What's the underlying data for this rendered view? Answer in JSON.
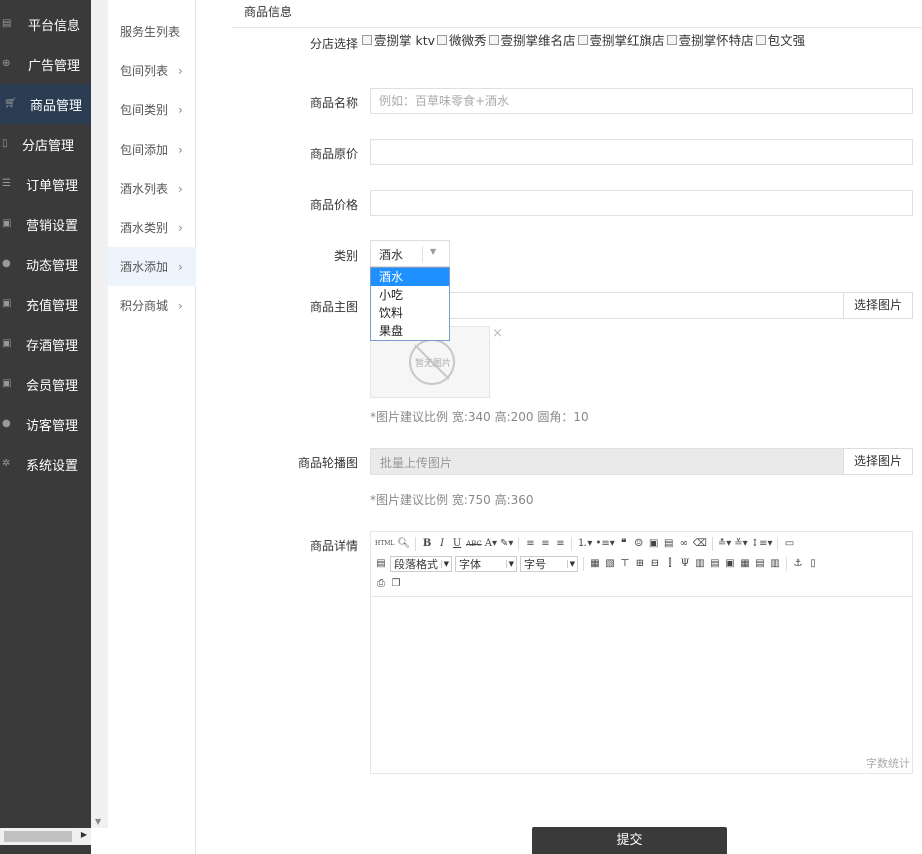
{
  "sidebar": {
    "items": [
      {
        "label": "平台信息",
        "icon": "info-icon"
      },
      {
        "label": "广告管理",
        "icon": "globe-icon"
      },
      {
        "label": "商品管理",
        "icon": "cart-icon",
        "active": true
      },
      {
        "label": "分店管理",
        "icon": "book-icon"
      },
      {
        "label": "订单管理",
        "icon": "list-icon"
      },
      {
        "label": "营销设置",
        "icon": "gift-icon"
      },
      {
        "label": "动态管理",
        "icon": "user-icon"
      },
      {
        "label": "充值管理",
        "icon": "gift-icon"
      },
      {
        "label": "存酒管理",
        "icon": "gift-icon"
      },
      {
        "label": "会员管理",
        "icon": "gift-icon"
      },
      {
        "label": "访客管理",
        "icon": "user-icon"
      },
      {
        "label": "系统设置",
        "icon": "gear-icon"
      }
    ]
  },
  "submenu": {
    "items": [
      {
        "label": "服务生列表",
        "chevron": false
      },
      {
        "label": "包间列表",
        "chevron": true
      },
      {
        "label": "包间类别",
        "chevron": true
      },
      {
        "label": "包间添加",
        "chevron": true
      },
      {
        "label": "酒水列表",
        "chevron": true
      },
      {
        "label": "酒水类别",
        "chevron": true
      },
      {
        "label": "酒水添加",
        "chevron": true,
        "active": true
      },
      {
        "label": "积分商城",
        "chevron": true
      }
    ],
    "chevron_glyph": "›"
  },
  "form": {
    "section_title": "商品信息",
    "branch_label": "分店选择",
    "branches": [
      "壹捌掌 ktv",
      "微微秀",
      "壹捌掌维名店",
      "壹捌掌红旗店",
      "壹捌掌怀特店",
      "包文强"
    ],
    "name_label": "商品名称",
    "name_placeholder": "例如：百草味零食+酒水",
    "orig_price_label": "商品原价",
    "price_label": "商品价格",
    "category_label": "类别",
    "category_selected": "酒水",
    "category_options": [
      "酒水",
      "小吃",
      "饮料",
      "果盘"
    ],
    "main_image_label": "商品主图",
    "choose_image_label": "选择图片",
    "no_image_text": "暂无图片",
    "close_glyph": "×",
    "main_image_hint": "*图片建议比例 宽:340 高:200 圆角：10",
    "carousel_label": "商品轮播图",
    "carousel_placeholder": "批量上传图片",
    "carousel_hint": "*图片建议比例 宽:750 高:360",
    "detail_label": "商品详情",
    "editor": {
      "paragraph_format": "段落格式",
      "font_family": "字体",
      "font_size": "字号",
      "word_count": "字数统计"
    },
    "submit_label": "提交"
  },
  "colors": {
    "sidebar_bg": "#3a3a3a",
    "sidebar_active": "#2b3d52",
    "submenu_active": "#eef4fb",
    "dropdown_selected": "#1e90ff",
    "submit_bg": "#3a3a3a"
  }
}
